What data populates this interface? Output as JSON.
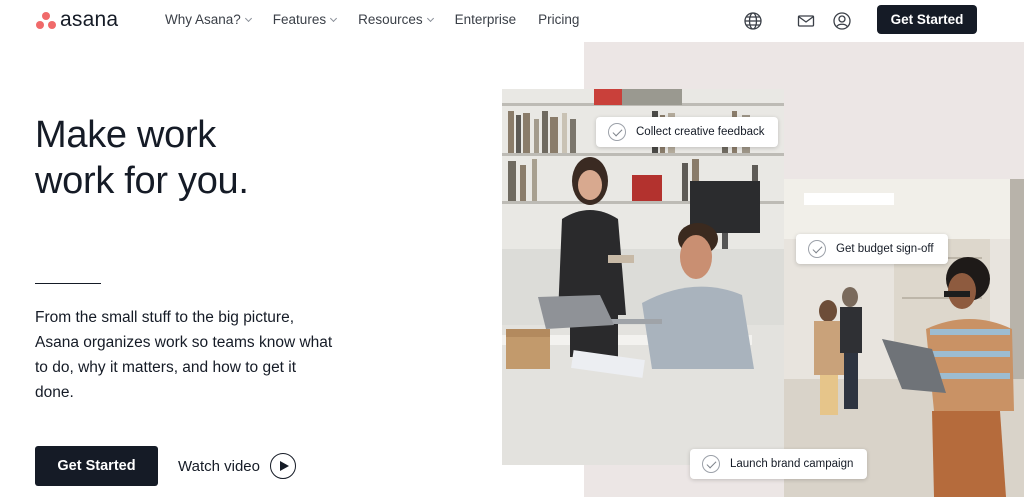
{
  "nav": {
    "logo_text": "asana",
    "links": [
      {
        "label": "Why Asana?",
        "dropdown": true
      },
      {
        "label": "Features",
        "dropdown": true
      },
      {
        "label": "Resources",
        "dropdown": true
      },
      {
        "label": "Enterprise",
        "dropdown": false
      },
      {
        "label": "Pricing",
        "dropdown": false
      }
    ],
    "icons": [
      "globe-icon",
      "mail-icon",
      "user-icon"
    ],
    "cta_label": "Get Started"
  },
  "hero": {
    "headline_line1": "Make work",
    "headline_line2": "work for you.",
    "description": "From the small stuff to the big picture, Asana organizes work so teams know what to do, why it matters, and how to get it done.",
    "cta_label": "Get Started",
    "watch_label": "Watch video"
  },
  "tasks": [
    {
      "label": "Collect creative feedback"
    },
    {
      "label": "Get budget sign-off"
    },
    {
      "label": "Launch brand campaign"
    }
  ],
  "colors": {
    "brand": "#f06a6a",
    "dark": "#151b26",
    "panel": "#ece6e5"
  }
}
